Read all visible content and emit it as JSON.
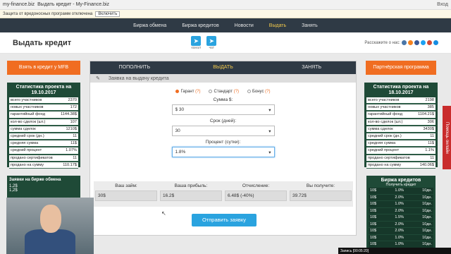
{
  "browser": {
    "url": "my-finance.biz",
    "title": "Выдать кредит - My-Finance.biz",
    "tools": "Вход"
  },
  "yabar": {
    "text": "Защита от вредоносных программ отключена",
    "button": "Включить"
  },
  "nav": [
    "Биржа обмена",
    "Биржа кредитов",
    "Новости",
    "Выдать",
    "Занять"
  ],
  "header": {
    "title": "Выдать кредит",
    "tg1": "канал",
    "tg2": "чат",
    "share": "Расскажите о нас:"
  },
  "left_button": "Взять в кредит у MFB",
  "right_button": "Партнёрская программа",
  "stat_left": {
    "title": "Статистика проекта на 19.10.2017",
    "rows": [
      [
        "всего участников",
        "2370"
      ],
      [
        "новых участников",
        "172"
      ],
      [
        "гарантийный фонд",
        "1144.38$"
      ],
      [
        "кол-во сделок (шт.)",
        "107"
      ],
      [
        "сумма сделок",
        "1210$"
      ],
      [
        "средний срок (дн.)",
        "11"
      ],
      [
        "средняя сумма",
        "11$"
      ],
      [
        "средний процент",
        "1.07%"
      ],
      [
        "продано сертификатов",
        "11"
      ],
      [
        "продано на сумму",
        "110.17$"
      ]
    ]
  },
  "stat_right": {
    "title": "Статистика проекта на 18.10.2017",
    "rows": [
      [
        "всего участников",
        "2198"
      ],
      [
        "новых участников",
        "385"
      ],
      [
        "гарантийный фонд",
        "1104.21$"
      ],
      [
        "кол-во сделок (шт.)",
        "306"
      ],
      [
        "сумма сделок",
        "3430$"
      ],
      [
        "средний срок (дн.)",
        "11"
      ],
      [
        "средняя сумма",
        "11$"
      ],
      [
        "средний процент",
        "1.1%"
      ],
      [
        "продано сертификатов",
        "11"
      ],
      [
        "продано на сумму",
        "140.06$"
      ]
    ]
  },
  "tabs": [
    "ПОПОЛНИТЬ",
    "ВЫДАТЬ",
    "ЗАНЯТЬ"
  ],
  "sub": "Заявка на выдачу кредита",
  "radios": [
    {
      "label": "Гарант",
      "q": "(?)",
      "selected": true
    },
    {
      "label": "Стандарт",
      "q": "(?)",
      "selected": false
    },
    {
      "label": "Бонус",
      "q": "(?)",
      "selected": false
    }
  ],
  "sum": {
    "label": "Сумма $:",
    "value": "$ 30"
  },
  "term": {
    "label": "Срок (дней):",
    "value": "30"
  },
  "pct": {
    "label": "Процент (сутки):",
    "value": "1.8%"
  },
  "calc": [
    {
      "label": "Ваш займ:",
      "value": "30$"
    },
    {
      "label": "Ваша прибыль:",
      "value": "16.2$"
    },
    {
      "label": "Отчисление:",
      "value": "6.48$ (-40%)"
    },
    {
      "label": "Вы получите:",
      "value": "39.72$"
    }
  ],
  "send": "Отправить заявку",
  "redtab": "Помощь онлайн",
  "left_ex": {
    "title": "Заявки на бирже обмена",
    "r1": "1,2$",
    "r2": "1,2$"
  },
  "right_ex": {
    "title": "Биржа кредитов",
    "sub": "Получить кредит",
    "rows": [
      [
        "10$",
        "1.0%",
        "10дн."
      ],
      [
        "10$",
        "2.0%",
        "10дн."
      ],
      [
        "10$",
        "1.0%",
        "10дн."
      ],
      [
        "10$",
        "2.0%",
        "10дн."
      ],
      [
        "10$",
        "1.5%",
        "10дн."
      ],
      [
        "10$",
        "2.0%",
        "10дн."
      ],
      [
        "10$",
        "2.0%",
        "10дн."
      ],
      [
        "10$",
        "1.0%",
        "10дн."
      ],
      [
        "10$",
        "1.0%",
        "10дн."
      ]
    ]
  },
  "taskbar": "Запись [00:05:20]"
}
